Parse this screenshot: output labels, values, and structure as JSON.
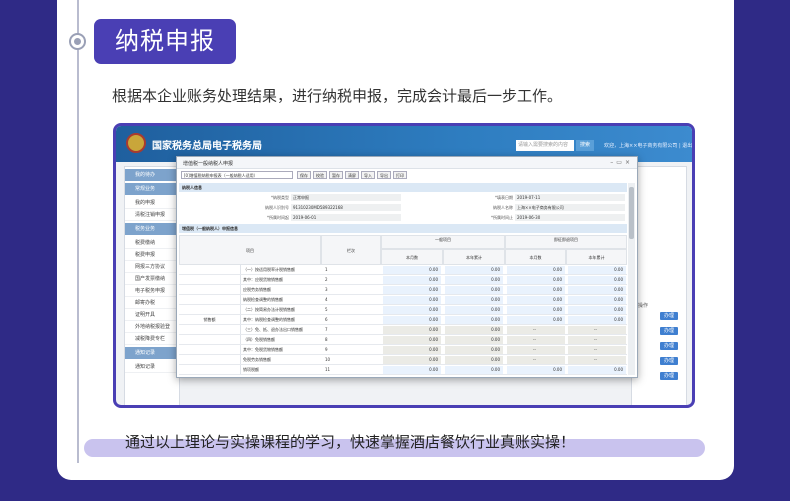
{
  "heading": "纳税申报",
  "intro": "根据本企业账务处理结果，进行纳税申报，完成会计最后一步工作。",
  "closing": "通过以上理论与实操课程的学习，快速掌握酒店餐饮行业真账实操！",
  "colors": {
    "accent": "#4a3fb4",
    "frame": "#2f2a86",
    "banner": "#c9c3ee"
  },
  "screenshot": {
    "site_title": "国家税务总局电子税务局",
    "search_placeholder": "请输入需要搜索的内容",
    "search_button": "搜索",
    "user_info": "欢迎，上海××电子商务有限公司 | 退出",
    "sidebar": {
      "items": [
        {
          "label": "我的待办",
          "type": "head"
        },
        {
          "label": "常规业务",
          "type": "head"
        },
        {
          "label": "我的申报",
          "type": "item"
        },
        {
          "label": "清税注销申报",
          "type": "item"
        },
        {
          "label": "税务业务",
          "type": "head"
        },
        {
          "label": "税费缴纳",
          "type": "item"
        },
        {
          "label": "税费申报",
          "type": "item"
        },
        {
          "label": "网报三方协议",
          "type": "item"
        },
        {
          "label": "国产发票缴纳",
          "type": "item"
        },
        {
          "label": "电子税务申报",
          "type": "item"
        },
        {
          "label": "邮寄办税",
          "type": "item"
        },
        {
          "label": "证明开具",
          "type": "item"
        },
        {
          "label": "外地纳税报验登",
          "type": "item"
        },
        {
          "label": "减税降费专栏",
          "type": "item"
        },
        {
          "label": "通知记录",
          "type": "head"
        },
        {
          "label": "通知记录",
          "type": "item"
        }
      ]
    },
    "right_panel": {
      "header": "操作",
      "buttons": [
        "办理",
        "办理",
        "办理",
        "办理",
        "办理"
      ]
    },
    "modal": {
      "title": "增值税一般纳税人申报",
      "form_select": "[0]增值税纳税申报表（一般纳税人适用）",
      "toolbar": [
        "保存",
        "校验",
        "暂存",
        "清屏",
        "导入",
        "导出",
        "打印"
      ],
      "section1": "纳税人信息",
      "fields": {
        "taxpayer_type_label": "*纳税类型",
        "taxpayer_type": "正常申报",
        "fill_date_label": "*填表日期",
        "fill_date": "2019-07-11",
        "taxpayer_id_label": "纳税人识别号",
        "taxpayer_id": "91310230MD589322168",
        "taxpayer_name_label": "纳税人名称",
        "taxpayer_name": "上海××电子商务有限公司",
        "period_start_label": "*所属时间起",
        "period_start": "2019-06-01",
        "period_end_label": "*所属时间止",
        "period_end": "2019-06-30"
      },
      "section2": "增值税（一般纳税人）申报信息",
      "grid_headers": {
        "item": "项目",
        "col_no": "栏次",
        "general": "一般项目",
        "instant": "即征即退项目",
        "this_month": "本月数",
        "year_total": "本年累计"
      },
      "merged_label": "销售额",
      "rows": [
        {
          "name": "（一）按适用税率计税销售额",
          "no": "1",
          "cells": [
            "0.00",
            "0.00",
            "0.00",
            "0.00"
          ],
          "kind": "ed"
        },
        {
          "name": "其中：应税货物销售额",
          "no": "2",
          "cells": [
            "0.00",
            "0.00",
            "0.00",
            "0.00"
          ],
          "kind": "ed"
        },
        {
          "name": "应税劳务销售额",
          "no": "3",
          "cells": [
            "0.00",
            "0.00",
            "0.00",
            "0.00"
          ],
          "kind": "ed"
        },
        {
          "name": "纳税检查调整的销售额",
          "no": "4",
          "cells": [
            "0.00",
            "0.00",
            "0.00",
            "0.00"
          ],
          "kind": "ed"
        },
        {
          "name": "（二）按简易办法计税销售额",
          "no": "5",
          "cells": [
            "0.00",
            "0.00",
            "0.00",
            "0.00"
          ],
          "kind": "ed"
        },
        {
          "name": "其中：纳税检查调整的销售额",
          "no": "6",
          "cells": [
            "0.00",
            "0.00",
            "0.00",
            "0.00"
          ],
          "kind": "ed"
        },
        {
          "name": "（三）免、抵、退办法出口销售额",
          "no": "7",
          "cells": [
            "0.00",
            "0.00",
            "--",
            "--"
          ],
          "kind": "ro"
        },
        {
          "name": "（四）免税销售额",
          "no": "8",
          "cells": [
            "0.00",
            "0.00",
            "--",
            "--"
          ],
          "kind": "ro"
        },
        {
          "name": "其中：免税货物销售额",
          "no": "9",
          "cells": [
            "0.00",
            "0.00",
            "--",
            "--"
          ],
          "kind": "ro"
        },
        {
          "name": "免税劳务销售额",
          "no": "10",
          "cells": [
            "0.00",
            "0.00",
            "--",
            "--"
          ],
          "kind": "ro"
        },
        {
          "name": "销项税额",
          "no": "11",
          "cells": [
            "0.00",
            "0.00",
            "0.00",
            "0.00"
          ],
          "kind": "ed"
        }
      ]
    }
  }
}
